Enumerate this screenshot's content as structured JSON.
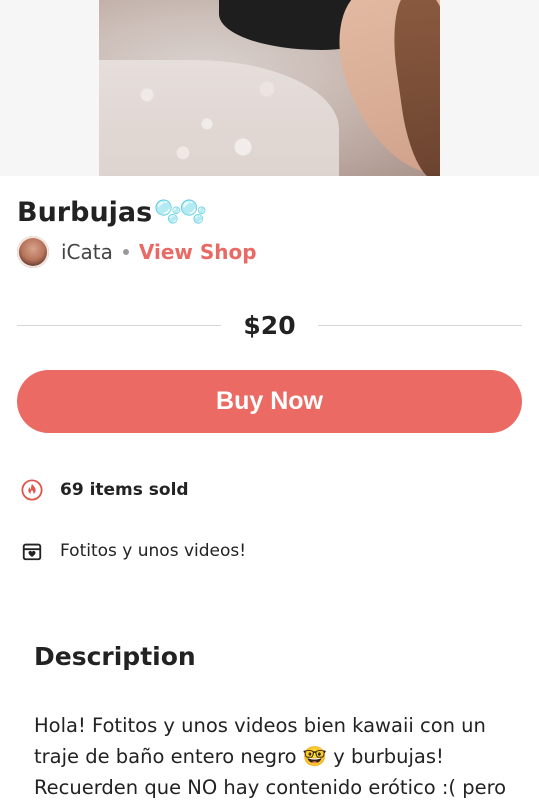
{
  "product": {
    "title": "Burbujas",
    "title_emoji": "🫧🫧",
    "seller_name": "iCata",
    "view_shop": "View Shop",
    "price": "$20",
    "buy_label": "Buy Now",
    "items_sold": "69 items sold",
    "bundle_text": "Fotitos y unos videos!"
  },
  "description": {
    "heading": "Description",
    "body": "Hola! Fotitos y unos videos bien kawaii con un traje de baño entero negro 🤓 y burbujas! Recuerden que NO hay contenido erótico :( pero"
  },
  "colors": {
    "accent": "#ec6a64",
    "fire_icon": "#e0574f"
  },
  "icons": {
    "sold": "fire-icon",
    "bundle": "gift-box-icon"
  }
}
